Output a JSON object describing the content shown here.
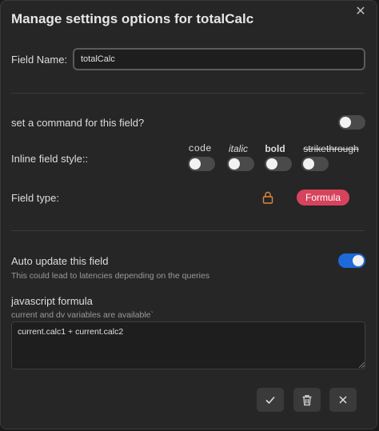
{
  "modal": {
    "title": "Manage settings options for totalCalc"
  },
  "field_name": {
    "label": "Field Name:",
    "value": "totalCalc"
  },
  "command": {
    "label": "set a command for this field?",
    "enabled": false
  },
  "inline_style": {
    "label": "Inline field style::",
    "options": [
      {
        "label": "code",
        "enabled": false
      },
      {
        "label": "italic",
        "enabled": false
      },
      {
        "label": "bold",
        "enabled": false
      },
      {
        "label": "strikethrough",
        "enabled": false
      }
    ]
  },
  "field_type": {
    "label": "Field type:",
    "value": "Formula",
    "badge_color": "#d7435c",
    "lock_icon": "lock-icon",
    "lock_color": "#e0873c"
  },
  "auto_update": {
    "label": "Auto update this field",
    "description": "This could lead to latencies depending on the queries",
    "enabled": true,
    "accent": "#1e6ad8"
  },
  "formula": {
    "label": "javascript formula",
    "description": "current and dv variables are available`",
    "value": "current.calc1 + current.calc2"
  },
  "actions": {
    "save_icon": "check-icon",
    "delete_icon": "trash-icon",
    "cancel_icon": "close-icon"
  }
}
